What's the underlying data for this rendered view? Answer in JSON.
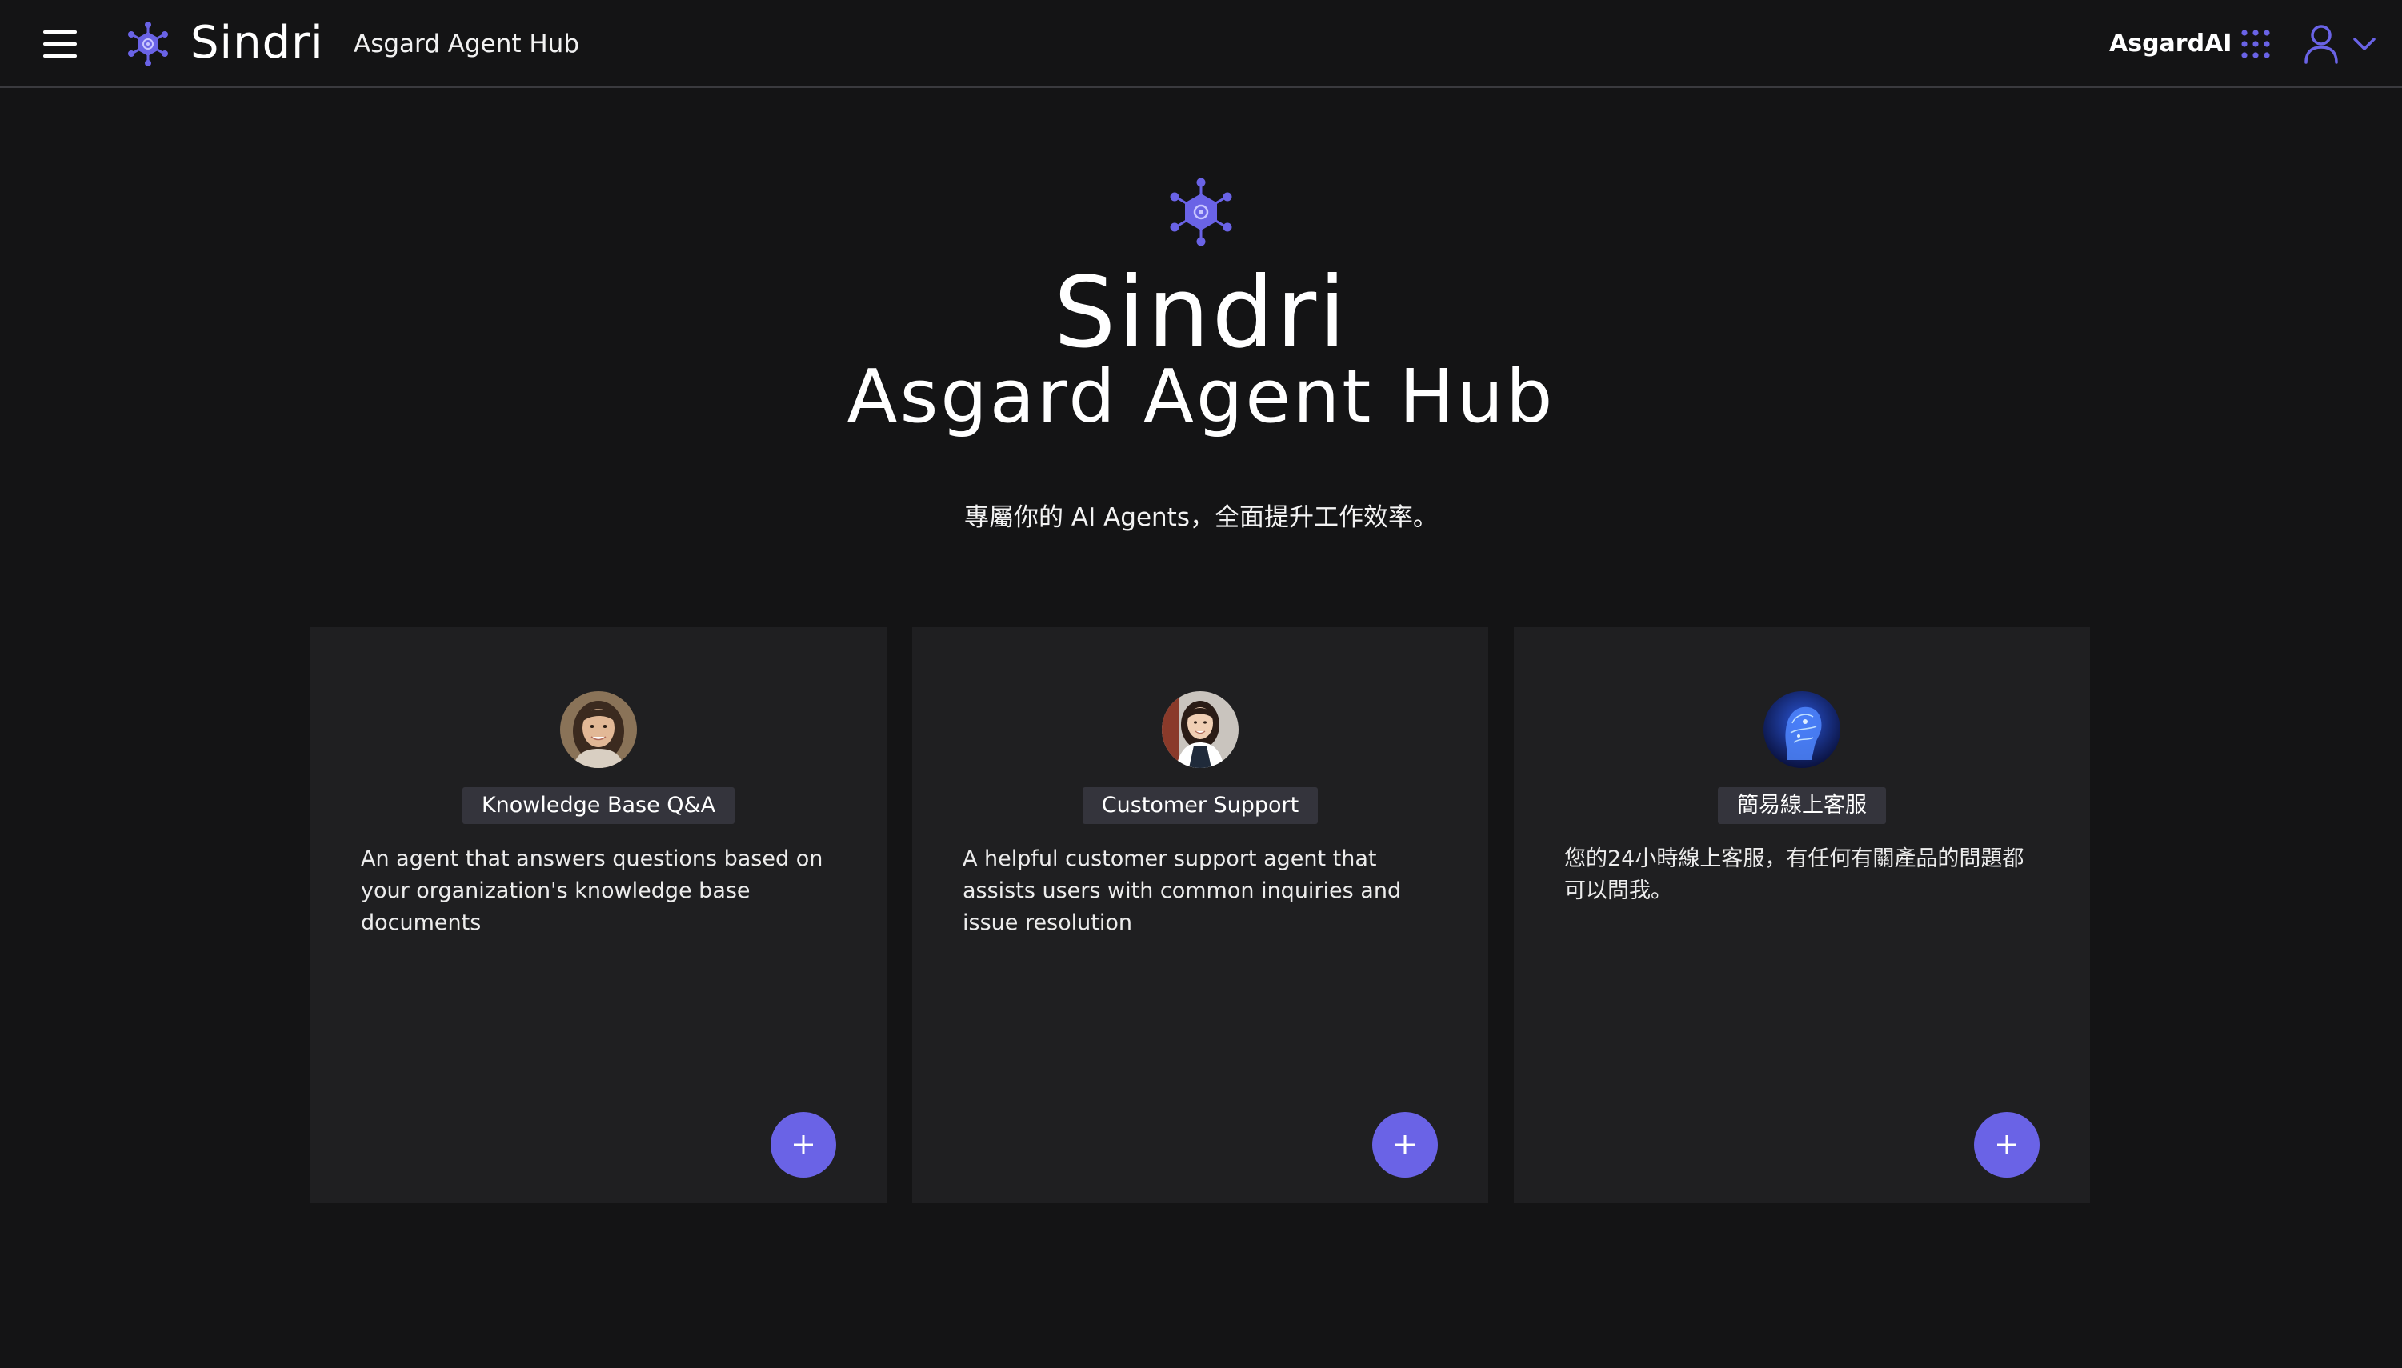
{
  "header": {
    "brand_name": "Sindri",
    "brand_subtitle": "Asgard Agent Hub",
    "org_name": "AsgardAI",
    "icons": [
      "menu-icon",
      "sindri-logo-icon",
      "apps-grid-icon",
      "user-icon",
      "chevron-down-icon"
    ]
  },
  "hero": {
    "title": "Sindri",
    "subtitle": "Asgard Agent Hub",
    "tagline": "專屬你的 AI Agents，全面提升工作效率。"
  },
  "agents": [
    {
      "name": "Knowledge Base Q&A",
      "description": "An agent that answers questions based on your organization's knowledge base documents",
      "avatar": "woman-portrait-avatar"
    },
    {
      "name": "Customer Support",
      "description": "A helpful customer support agent that assists users with common inquiries and issue resolution",
      "avatar": "support-woman-avatar"
    },
    {
      "name": "簡易線上客服",
      "description": "您的24小時線上客服，有任何有關產品的問題都可以問我。",
      "avatar": "ai-head-avatar"
    }
  ],
  "colors": {
    "background": "#141415",
    "card": "#1f1f21",
    "tag": "#34343c",
    "accent": "#6a63e6",
    "divider": "#3a3a3e"
  }
}
